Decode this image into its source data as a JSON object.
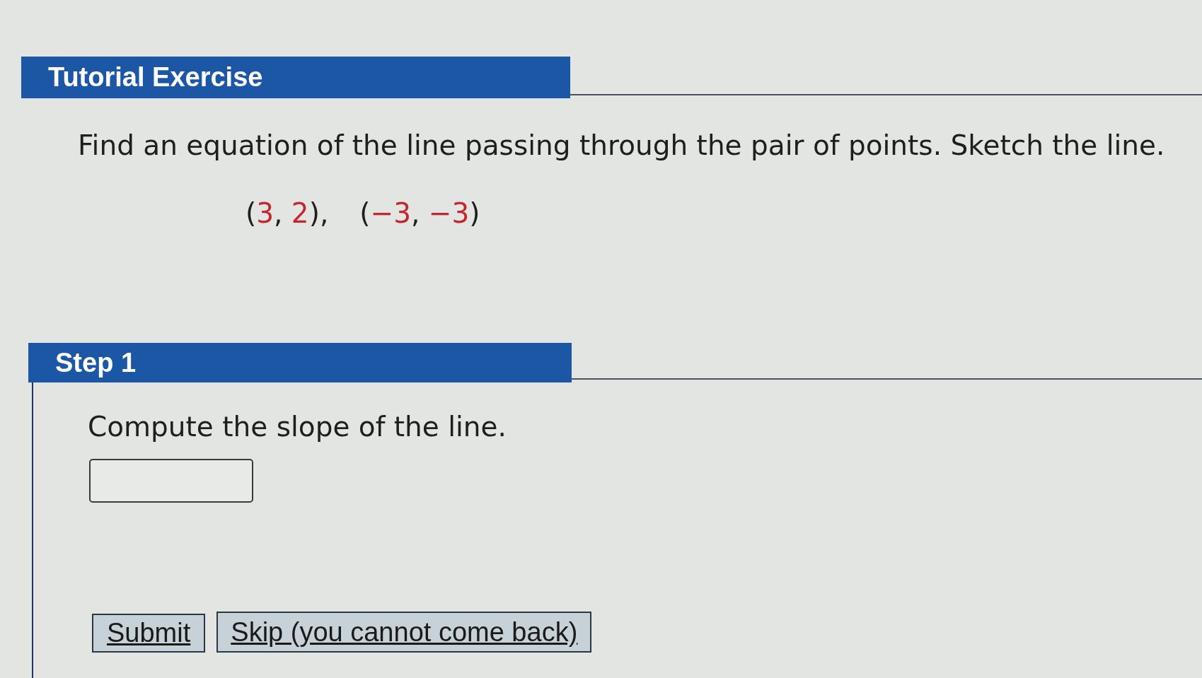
{
  "tutorial": {
    "title": "Tutorial Exercise",
    "prompt": "Find an equation of the line passing through the pair of points. Sketch the line.",
    "points": [
      {
        "tokens": [
          {
            "kind": "punct",
            "text": "("
          },
          {
            "kind": "number",
            "text": "3"
          },
          {
            "kind": "punct",
            "text": ", "
          },
          {
            "kind": "number",
            "text": "2"
          },
          {
            "kind": "punct",
            "text": "),"
          }
        ]
      },
      {
        "tokens": [
          {
            "kind": "punct",
            "text": "("
          },
          {
            "kind": "number",
            "text": "−3"
          },
          {
            "kind": "punct",
            "text": ", "
          },
          {
            "kind": "number",
            "text": "−3"
          },
          {
            "kind": "punct",
            "text": ")"
          }
        ]
      }
    ]
  },
  "step": {
    "title": "Step 1",
    "instruction": "Compute the slope of the line.",
    "buttons": [
      {
        "label": "Submit"
      },
      {
        "label": "Skip (you cannot come back)"
      }
    ]
  }
}
